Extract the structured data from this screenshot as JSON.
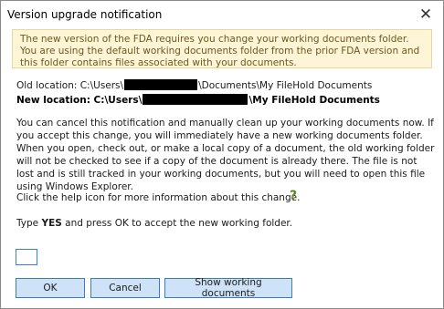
{
  "window": {
    "title": "Version upgrade notification",
    "close_glyph": "✕"
  },
  "banner": {
    "text": "The new version of the FDA requires you change your working documents folder. You are using the default working documents folder from the prior FDA version and this folder contains files associated with your documents."
  },
  "locations": {
    "old_label": "Old location: C:\\Users\\",
    "old_suffix": "\\Documents\\My FileHold Documents",
    "new_label": "New location: C:\\Users\\",
    "new_suffix": "\\My FileHold Documents"
  },
  "body": {
    "main_text": "You can cancel this notification and manually clean up your working documents now. If you accept this change, you will immediately have a new working documents folder. When you open, check out, or make a local copy of a document, the old working folder will not be checked to see if a copy of the document is already there. The file is not lost and is still tracked in your working documents, but you will need to open this file using Windows Explorer.",
    "help_text": "Click the help icon for more information about this change.",
    "help_icon": "?",
    "type_prefix": "Type ",
    "type_keyword": "YES",
    "type_suffix": " and press OK to accept the new working folder."
  },
  "confirm": {
    "value": "",
    "placeholder": ""
  },
  "buttons": {
    "ok": "OK",
    "cancel": "Cancel",
    "show_docs": "Show working documents"
  },
  "colors": {
    "banner_bg": "#fdf5d5",
    "button_bg": "#cfe3f8",
    "button_border": "#3d7bc4",
    "help_icon": "#5a8a1a"
  }
}
